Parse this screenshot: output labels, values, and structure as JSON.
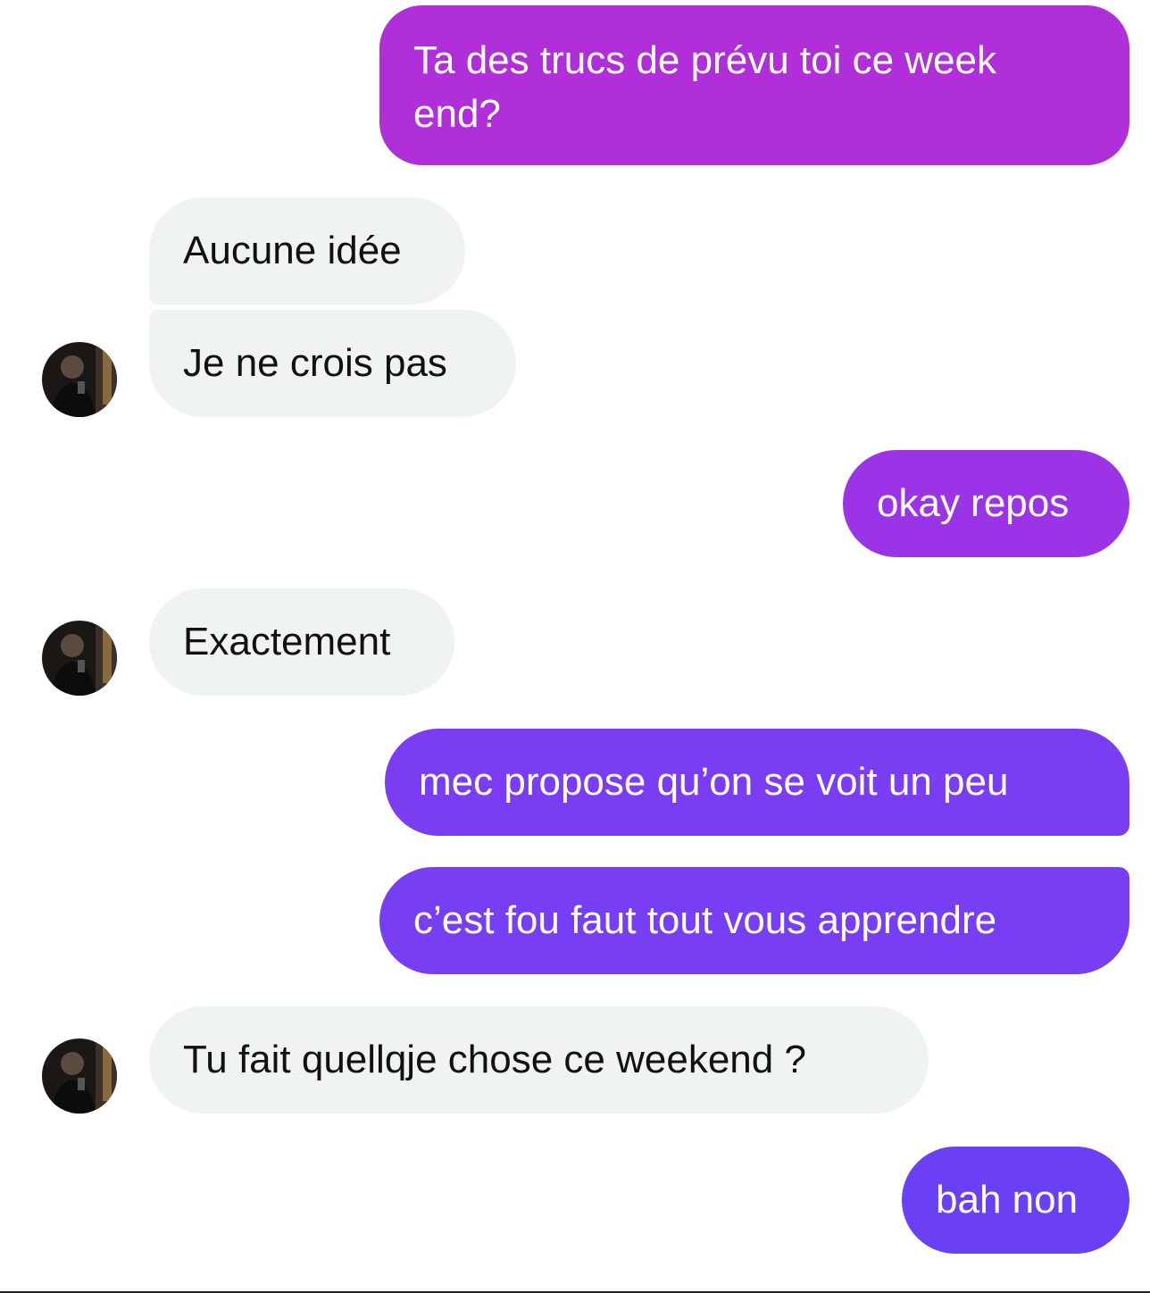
{
  "conversation": {
    "messages": [
      {
        "sender": "me",
        "text": "Ta des trucs de prévu toi ce week end?"
      },
      {
        "sender": "contact",
        "text": "Aucune idée"
      },
      {
        "sender": "contact",
        "text": "Je ne crois pas"
      },
      {
        "sender": "me",
        "text": "okay repos"
      },
      {
        "sender": "contact",
        "text": "Exactement"
      },
      {
        "sender": "me",
        "text": "mec propose qu’on se voit un peu"
      },
      {
        "sender": "me",
        "text": "c’est fou faut tout vous apprendre"
      },
      {
        "sender": "contact",
        "text": "Tu fait quellqje chose ce weekend ?"
      },
      {
        "sender": "me",
        "text": "bah non"
      }
    ]
  },
  "colors": {
    "sent_top": "#b22fd8",
    "sent_bottom": "#6a3ef5",
    "received_bg": "#f0f3f4",
    "received_text": "#111111",
    "sent_text": "#ffffff"
  },
  "icons": {
    "avatar": "contact-avatar-photo"
  }
}
